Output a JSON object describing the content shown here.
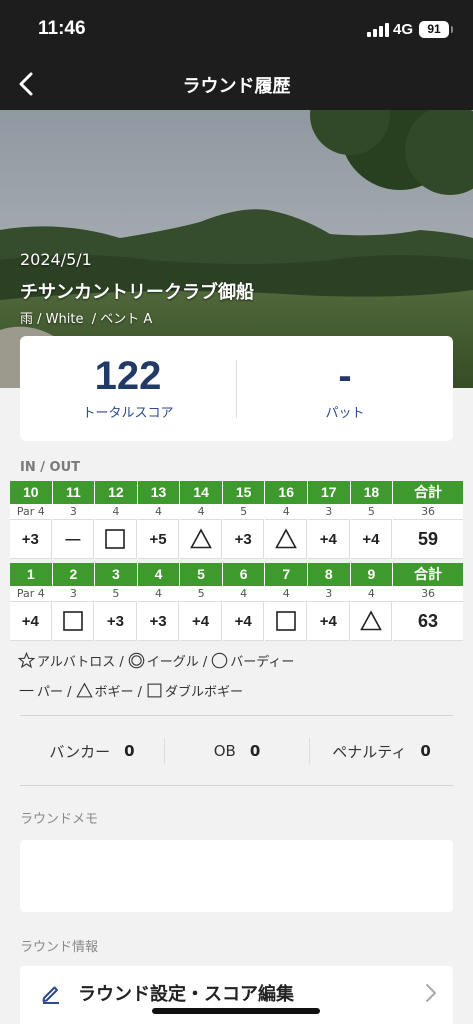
{
  "status_bar": {
    "time": "11:46",
    "network": "4G",
    "battery": "91"
  },
  "nav": {
    "title": "ラウンド履歴"
  },
  "round": {
    "date": "2024/5/1",
    "course": "チサンカントリークラブ御船",
    "meta": "雨 / White  / ベント A"
  },
  "summary": {
    "total_score": "122",
    "total_label": "トータルスコア",
    "putts": "-",
    "putts_label": "パット"
  },
  "scorecard": {
    "label": "IN / OUT",
    "in": {
      "holes": [
        "10",
        "11",
        "12",
        "13",
        "14",
        "15",
        "16",
        "17",
        "18",
        "合計"
      ],
      "pars": [
        "Par 4",
        "3",
        "4",
        "4",
        "4",
        "5",
        "4",
        "3",
        "5",
        "36"
      ],
      "scores": [
        "+3",
        "―",
        "square",
        "+5",
        "triangle",
        "+3",
        "triangle",
        "+4",
        "+4",
        "59"
      ]
    },
    "out": {
      "holes": [
        "1",
        "2",
        "3",
        "4",
        "5",
        "6",
        "7",
        "8",
        "9",
        "合計"
      ],
      "pars": [
        "Par 4",
        "3",
        "5",
        "4",
        "5",
        "4",
        "4",
        "3",
        "4",
        "36"
      ],
      "scores": [
        "+4",
        "square",
        "+3",
        "+3",
        "+4",
        "+4",
        "square",
        "+4",
        "triangle",
        "63"
      ]
    }
  },
  "legend": {
    "albatross": "アルバトロス /",
    "eagle": "イーグル /",
    "birdie": "バーディー",
    "par": "パー /",
    "bogey": "ボギー /",
    "double_bogey": "ダブルボギー"
  },
  "stats": {
    "bunker_label": "バンカー",
    "bunker_value": "0",
    "ob_label": "OB",
    "ob_value": "0",
    "penalty_label": "ペナルティ",
    "penalty_value": "0"
  },
  "memo": {
    "label": "ラウンドメモ"
  },
  "info": {
    "label": "ラウンド情報",
    "settings_label": "ラウンド設定・スコア編集"
  },
  "colors": {
    "header_bg": "#1d1d1d",
    "hole_green": "#3f9a2e",
    "score_navy": "#223a66"
  }
}
